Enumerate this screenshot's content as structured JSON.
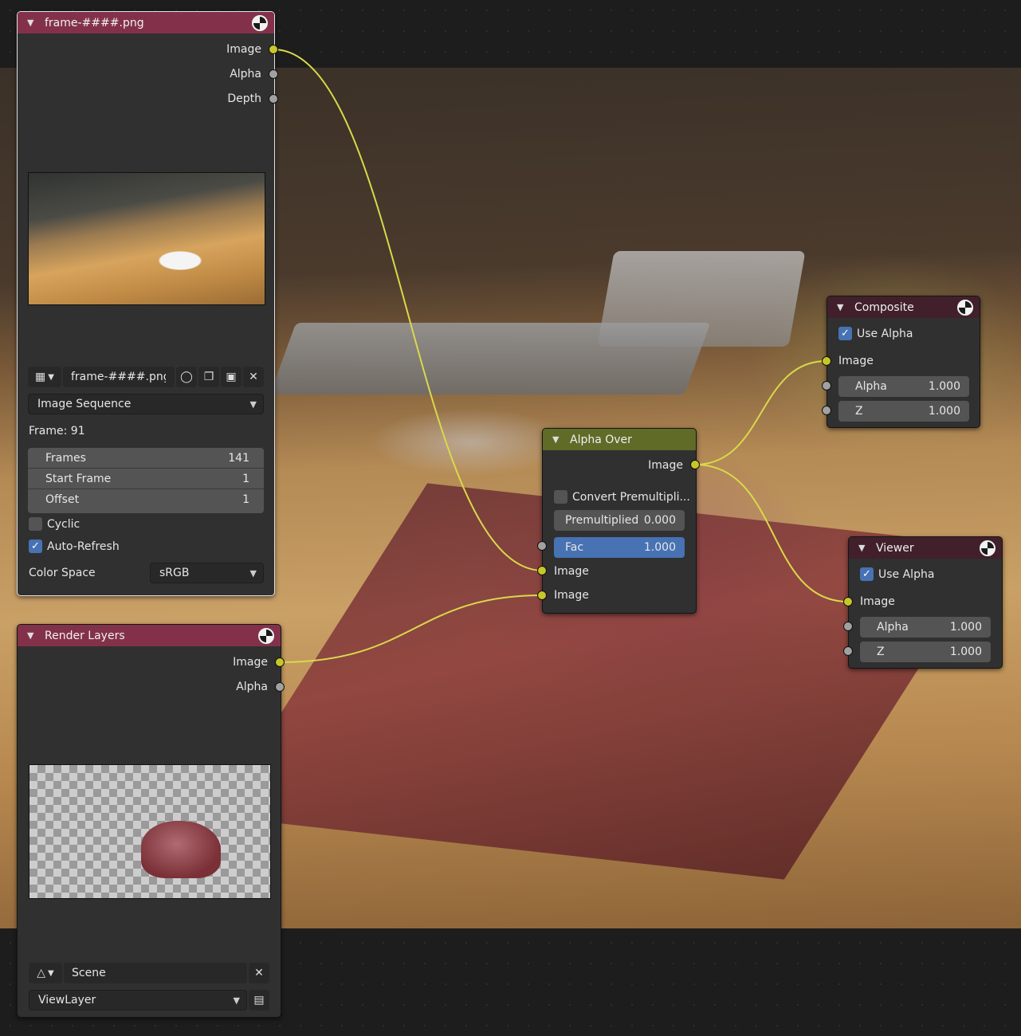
{
  "image_node": {
    "title": "frame-####.png",
    "outputs": [
      "Image",
      "Alpha",
      "Depth"
    ],
    "image_name": "frame-####.png",
    "source": "Image Sequence",
    "frame_label": "Frame: 91",
    "frames_label": "Frames",
    "frames_value": "141",
    "start_frame_label": "Start Frame",
    "start_frame_value": "1",
    "offset_label": "Offset",
    "offset_value": "1",
    "cyclic_label": "Cyclic",
    "cyclic_checked": false,
    "auto_refresh_label": "Auto-Refresh",
    "auto_refresh_checked": true,
    "color_space_label": "Color Space",
    "color_space_value": "sRGB"
  },
  "render_layers_node": {
    "title": "Render Layers",
    "outputs": [
      "Image",
      "Alpha"
    ],
    "scene": "Scene",
    "view_layer": "ViewLayer"
  },
  "alpha_over_node": {
    "title": "Alpha Over",
    "output": "Image",
    "convert_premultiplied_label": "Convert Premultipli...",
    "convert_premultiplied_checked": false,
    "premultiplied_label": "Premultiplied",
    "premultiplied_value": "0.000",
    "fac_label": "Fac",
    "fac_value": "1.000",
    "inputs": [
      "Image",
      "Image"
    ]
  },
  "composite_node": {
    "title": "Composite",
    "use_alpha_label": "Use Alpha",
    "use_alpha_checked": true,
    "input_image": "Image",
    "alpha_label": "Alpha",
    "alpha_value": "1.000",
    "z_label": "Z",
    "z_value": "1.000"
  },
  "viewer_node": {
    "title": "Viewer",
    "use_alpha_label": "Use Alpha",
    "use_alpha_checked": true,
    "input_image": "Image",
    "alpha_label": "Alpha",
    "alpha_value": "1.000",
    "z_label": "Z",
    "z_value": "1.000"
  },
  "icons": {
    "collapse": "chevron-down-icon",
    "node_type": "globe-checker-icon",
    "image_browse": "image-icon",
    "fake_user": "shield-icon",
    "duplicate": "duplicate-icon",
    "open": "folder-icon",
    "unlink": "close-icon",
    "scene_browse": "scene-icon",
    "render_layer": "render-layer-icon"
  },
  "colors": {
    "image_socket": "#c7c729",
    "value_socket": "#a1a1a1",
    "input_header": "#83314a",
    "mix_header": "#606b27",
    "output_header": "#41202b",
    "selected_field": "#4772b3",
    "wire": "#d9d94a"
  }
}
